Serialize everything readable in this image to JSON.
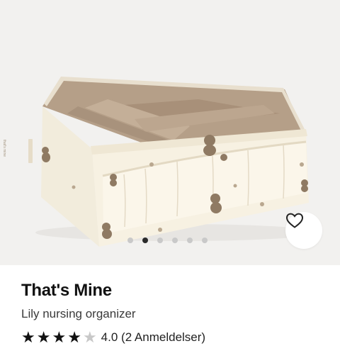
{
  "product": {
    "brand": "That's Mine",
    "name": "Lily nursing organizer",
    "rating_text": "4.0 (2 Anmeldelser)",
    "rating_value": 4,
    "rating_max": 5
  },
  "gallery": {
    "dot_count": 6,
    "active_index": 1,
    "favorite_icon": "heart-outline-icon",
    "tag_text": "that's mine"
  },
  "colors": {
    "image_bg": "#f2f1ef",
    "accent_dark": "#2a2a2a"
  }
}
